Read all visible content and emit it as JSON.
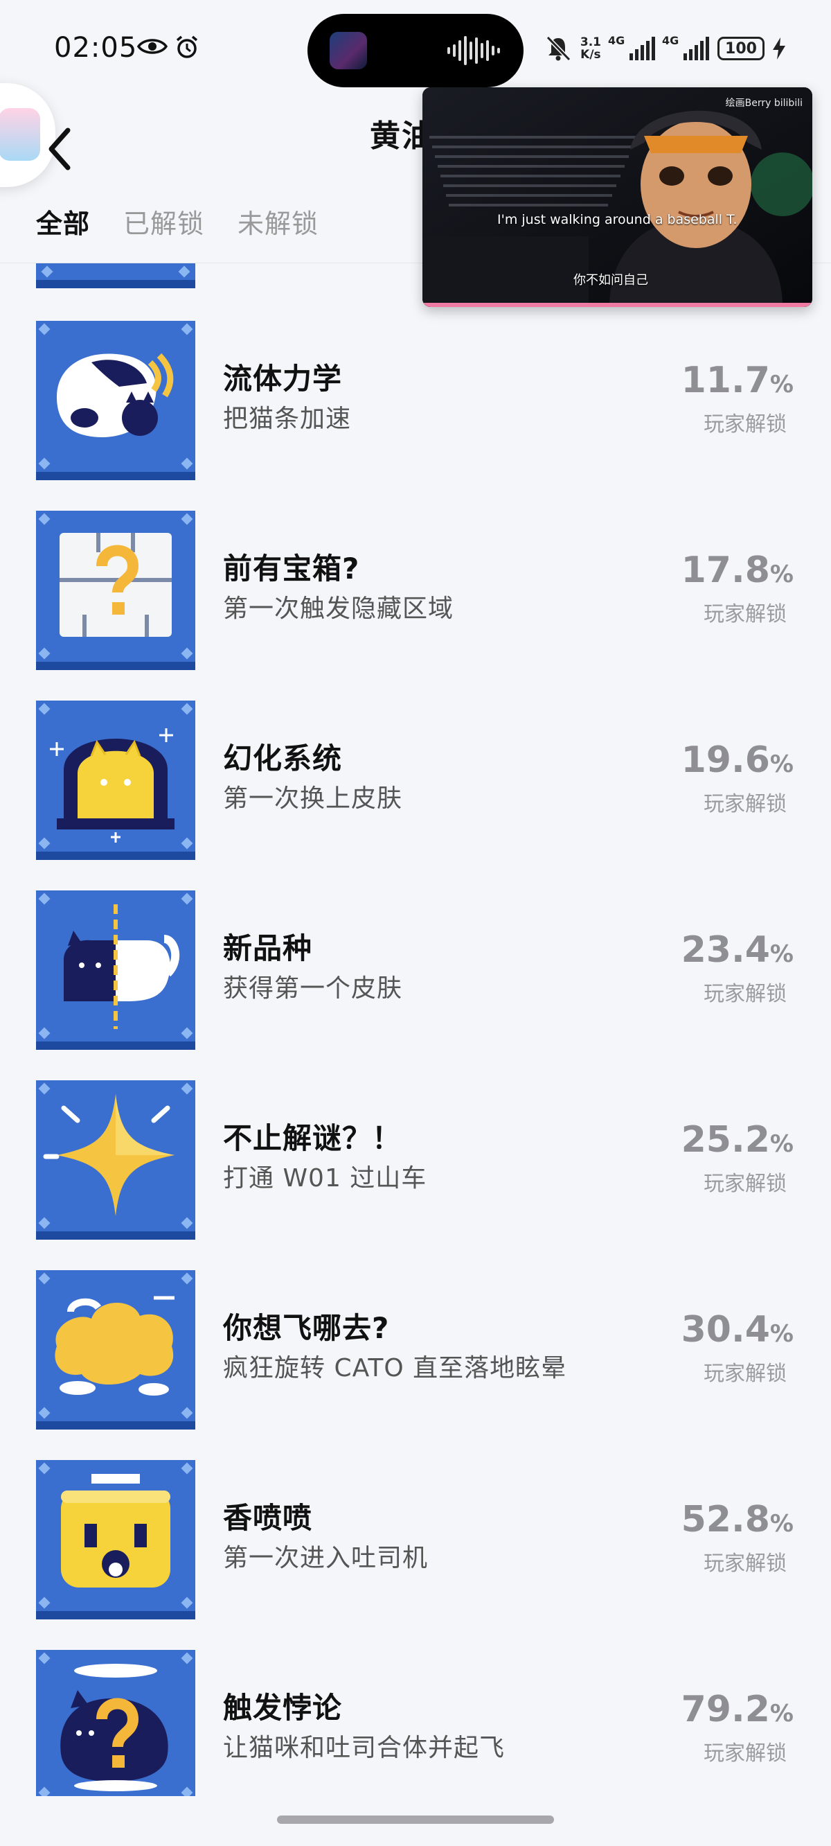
{
  "status_bar": {
    "time": "02:05",
    "net_speed_top": "3.1",
    "net_speed_bottom": "K/s",
    "sig1_label": "4G",
    "sig2_label": "4G",
    "battery": "100"
  },
  "header": {
    "title": "黄油",
    "tabs": [
      "全部",
      "已解锁",
      "未解锁"
    ]
  },
  "video": {
    "subtitle_en": "I'm just walking around a baseball T.",
    "subtitle_zh": "你不如问自己",
    "watermark": "绘画Berry bilibili"
  },
  "unlock_label": "玩家解锁",
  "achievements": [
    {
      "name": "流体力学",
      "desc": "把猫条加速",
      "pct": "11.7",
      "unit": "%",
      "icon": "cat-dash-icon"
    },
    {
      "name": "前有宝箱?",
      "desc": "第一次触发隐藏区域",
      "pct": "17.8",
      "unit": "%",
      "icon": "mystery-chest-icon"
    },
    {
      "name": "幻化系统",
      "desc": "第一次换上皮肤",
      "pct": "19.6",
      "unit": "%",
      "icon": "cat-window-icon"
    },
    {
      "name": "新品种",
      "desc": "获得第一个皮肤",
      "pct": "23.4",
      "unit": "%",
      "icon": "split-cat-icon"
    },
    {
      "name": "不止解谜？！",
      "desc": "打通 W01 过山车",
      "pct": "25.2",
      "unit": "%",
      "icon": "star-sparkle-icon"
    },
    {
      "name": "你想飞哪去?",
      "desc": "疯狂旋转 CATO 直至落地眩晕",
      "pct": "30.4",
      "unit": "%",
      "icon": "dizzy-cloud-icon"
    },
    {
      "name": "香喷喷",
      "desc": "第一次进入吐司机",
      "pct": "52.8",
      "unit": "%",
      "icon": "toast-face-icon"
    },
    {
      "name": "触发悖论",
      "desc": "让猫咪和吐司合体并起飞",
      "pct": "79.2",
      "unit": "%",
      "icon": "paradox-cat-icon"
    }
  ]
}
